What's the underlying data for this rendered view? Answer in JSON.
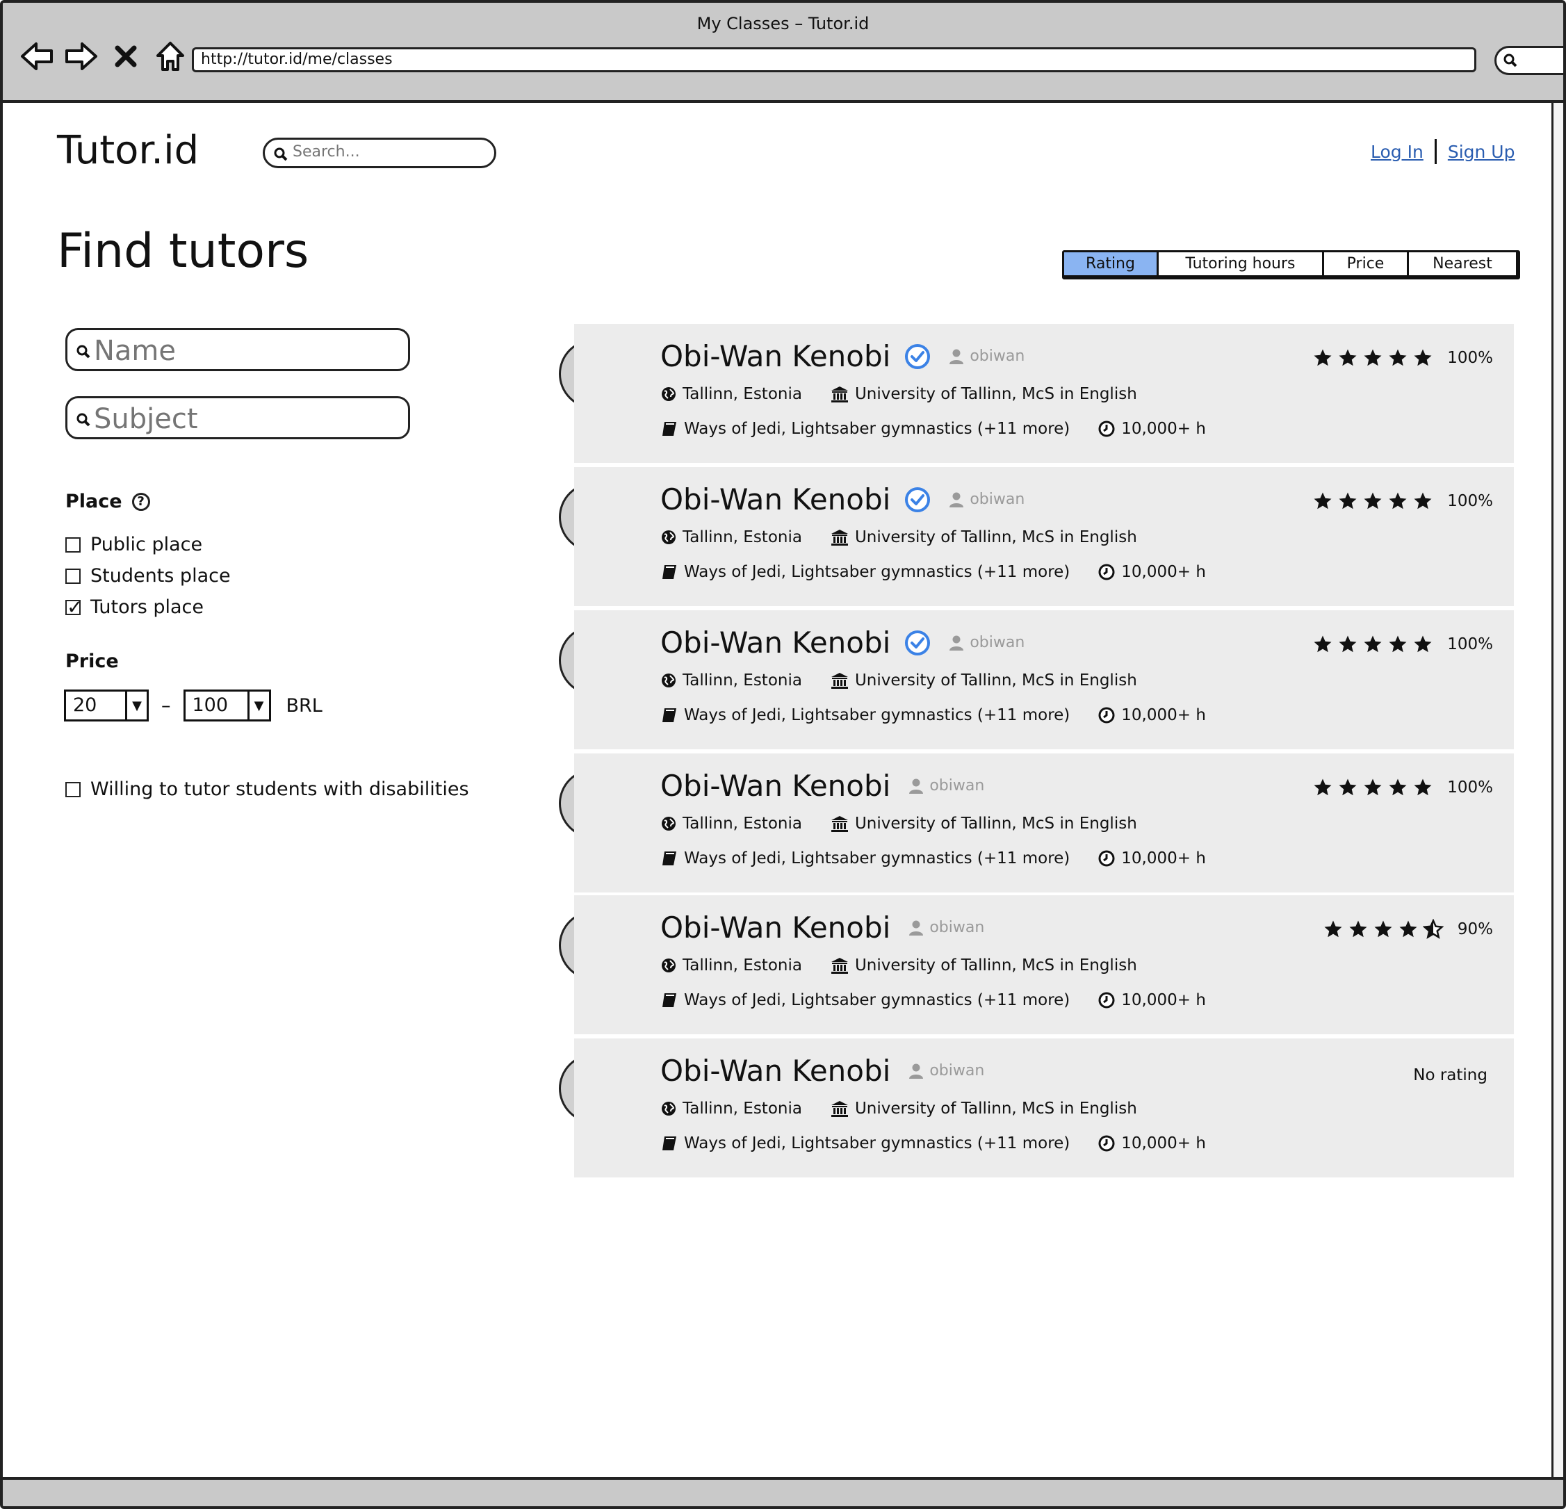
{
  "window": {
    "title": "My Classes – Tutor.id",
    "url": "http://tutor.id/me/classes"
  },
  "header": {
    "logo": "Tutor.id",
    "search_placeholder": "Search...",
    "login": "Log In",
    "signup": "Sign Up"
  },
  "page_title": "Find tutors",
  "sort": {
    "options": [
      "Rating",
      "Tutoring hours",
      "Price",
      "Nearest"
    ],
    "active": "Rating"
  },
  "filters": {
    "name_placeholder": "Name",
    "subject_placeholder": "Subject",
    "place_label": "Place",
    "place_help": "?",
    "places": [
      {
        "label": "Public place",
        "checked": false
      },
      {
        "label": "Students place",
        "checked": false
      },
      {
        "label": "Tutors place",
        "checked": true
      }
    ],
    "price_label": "Price",
    "price_min": "20",
    "price_max": "100",
    "price_dash": "–",
    "currency": "BRL",
    "disabilities_label": "Willing to tutor students with disabilities",
    "disabilities_checked": false
  },
  "tutors": [
    {
      "name": "Obi-Wan Kenobi",
      "verified": true,
      "username": "obiwan",
      "location": "Tallinn, Estonia",
      "education": "University of Tallinn, McS in English",
      "subjects": "Ways of Jedi, Lightsaber gymnastics (+11 more)",
      "hours": "10,000+ h",
      "stars": 5,
      "rating": "100%"
    },
    {
      "name": "Obi-Wan Kenobi",
      "verified": true,
      "username": "obiwan",
      "location": "Tallinn, Estonia",
      "education": "University of Tallinn, McS in English",
      "subjects": "Ways of Jedi, Lightsaber gymnastics (+11 more)",
      "hours": "10,000+ h",
      "stars": 5,
      "rating": "100%"
    },
    {
      "name": "Obi-Wan Kenobi",
      "verified": true,
      "username": "obiwan",
      "location": "Tallinn, Estonia",
      "education": "University of Tallinn, McS in English",
      "subjects": "Ways of Jedi, Lightsaber gymnastics (+11 more)",
      "hours": "10,000+ h",
      "stars": 5,
      "rating": "100%"
    },
    {
      "name": "Obi-Wan Kenobi",
      "verified": false,
      "username": "obiwan",
      "location": "Tallinn, Estonia",
      "education": "University of Tallinn, McS in English",
      "subjects": "Ways of Jedi, Lightsaber gymnastics (+11 more)",
      "hours": "10,000+ h",
      "stars": 5,
      "rating": "100%"
    },
    {
      "name": "Obi-Wan Kenobi",
      "verified": false,
      "username": "obiwan",
      "location": "Tallinn, Estonia",
      "education": "University of Tallinn, McS in English",
      "subjects": "Ways of Jedi, Lightsaber gymnastics (+11 more)",
      "hours": "10,000+ h",
      "stars": 4.5,
      "rating": "90%"
    },
    {
      "name": "Obi-Wan Kenobi",
      "verified": false,
      "username": "obiwan",
      "location": "Tallinn, Estonia",
      "education": "University of Tallinn, McS in English",
      "subjects": "Ways of Jedi, Lightsaber gymnastics (+11 more)",
      "hours": "10,000+ h",
      "stars": 0,
      "rating": "No rating"
    }
  ],
  "colors": {
    "accent": "#8ab4f2",
    "verified": "#3b82e6",
    "card_bg": "#ececec",
    "chrome": "#c9c9c9"
  }
}
